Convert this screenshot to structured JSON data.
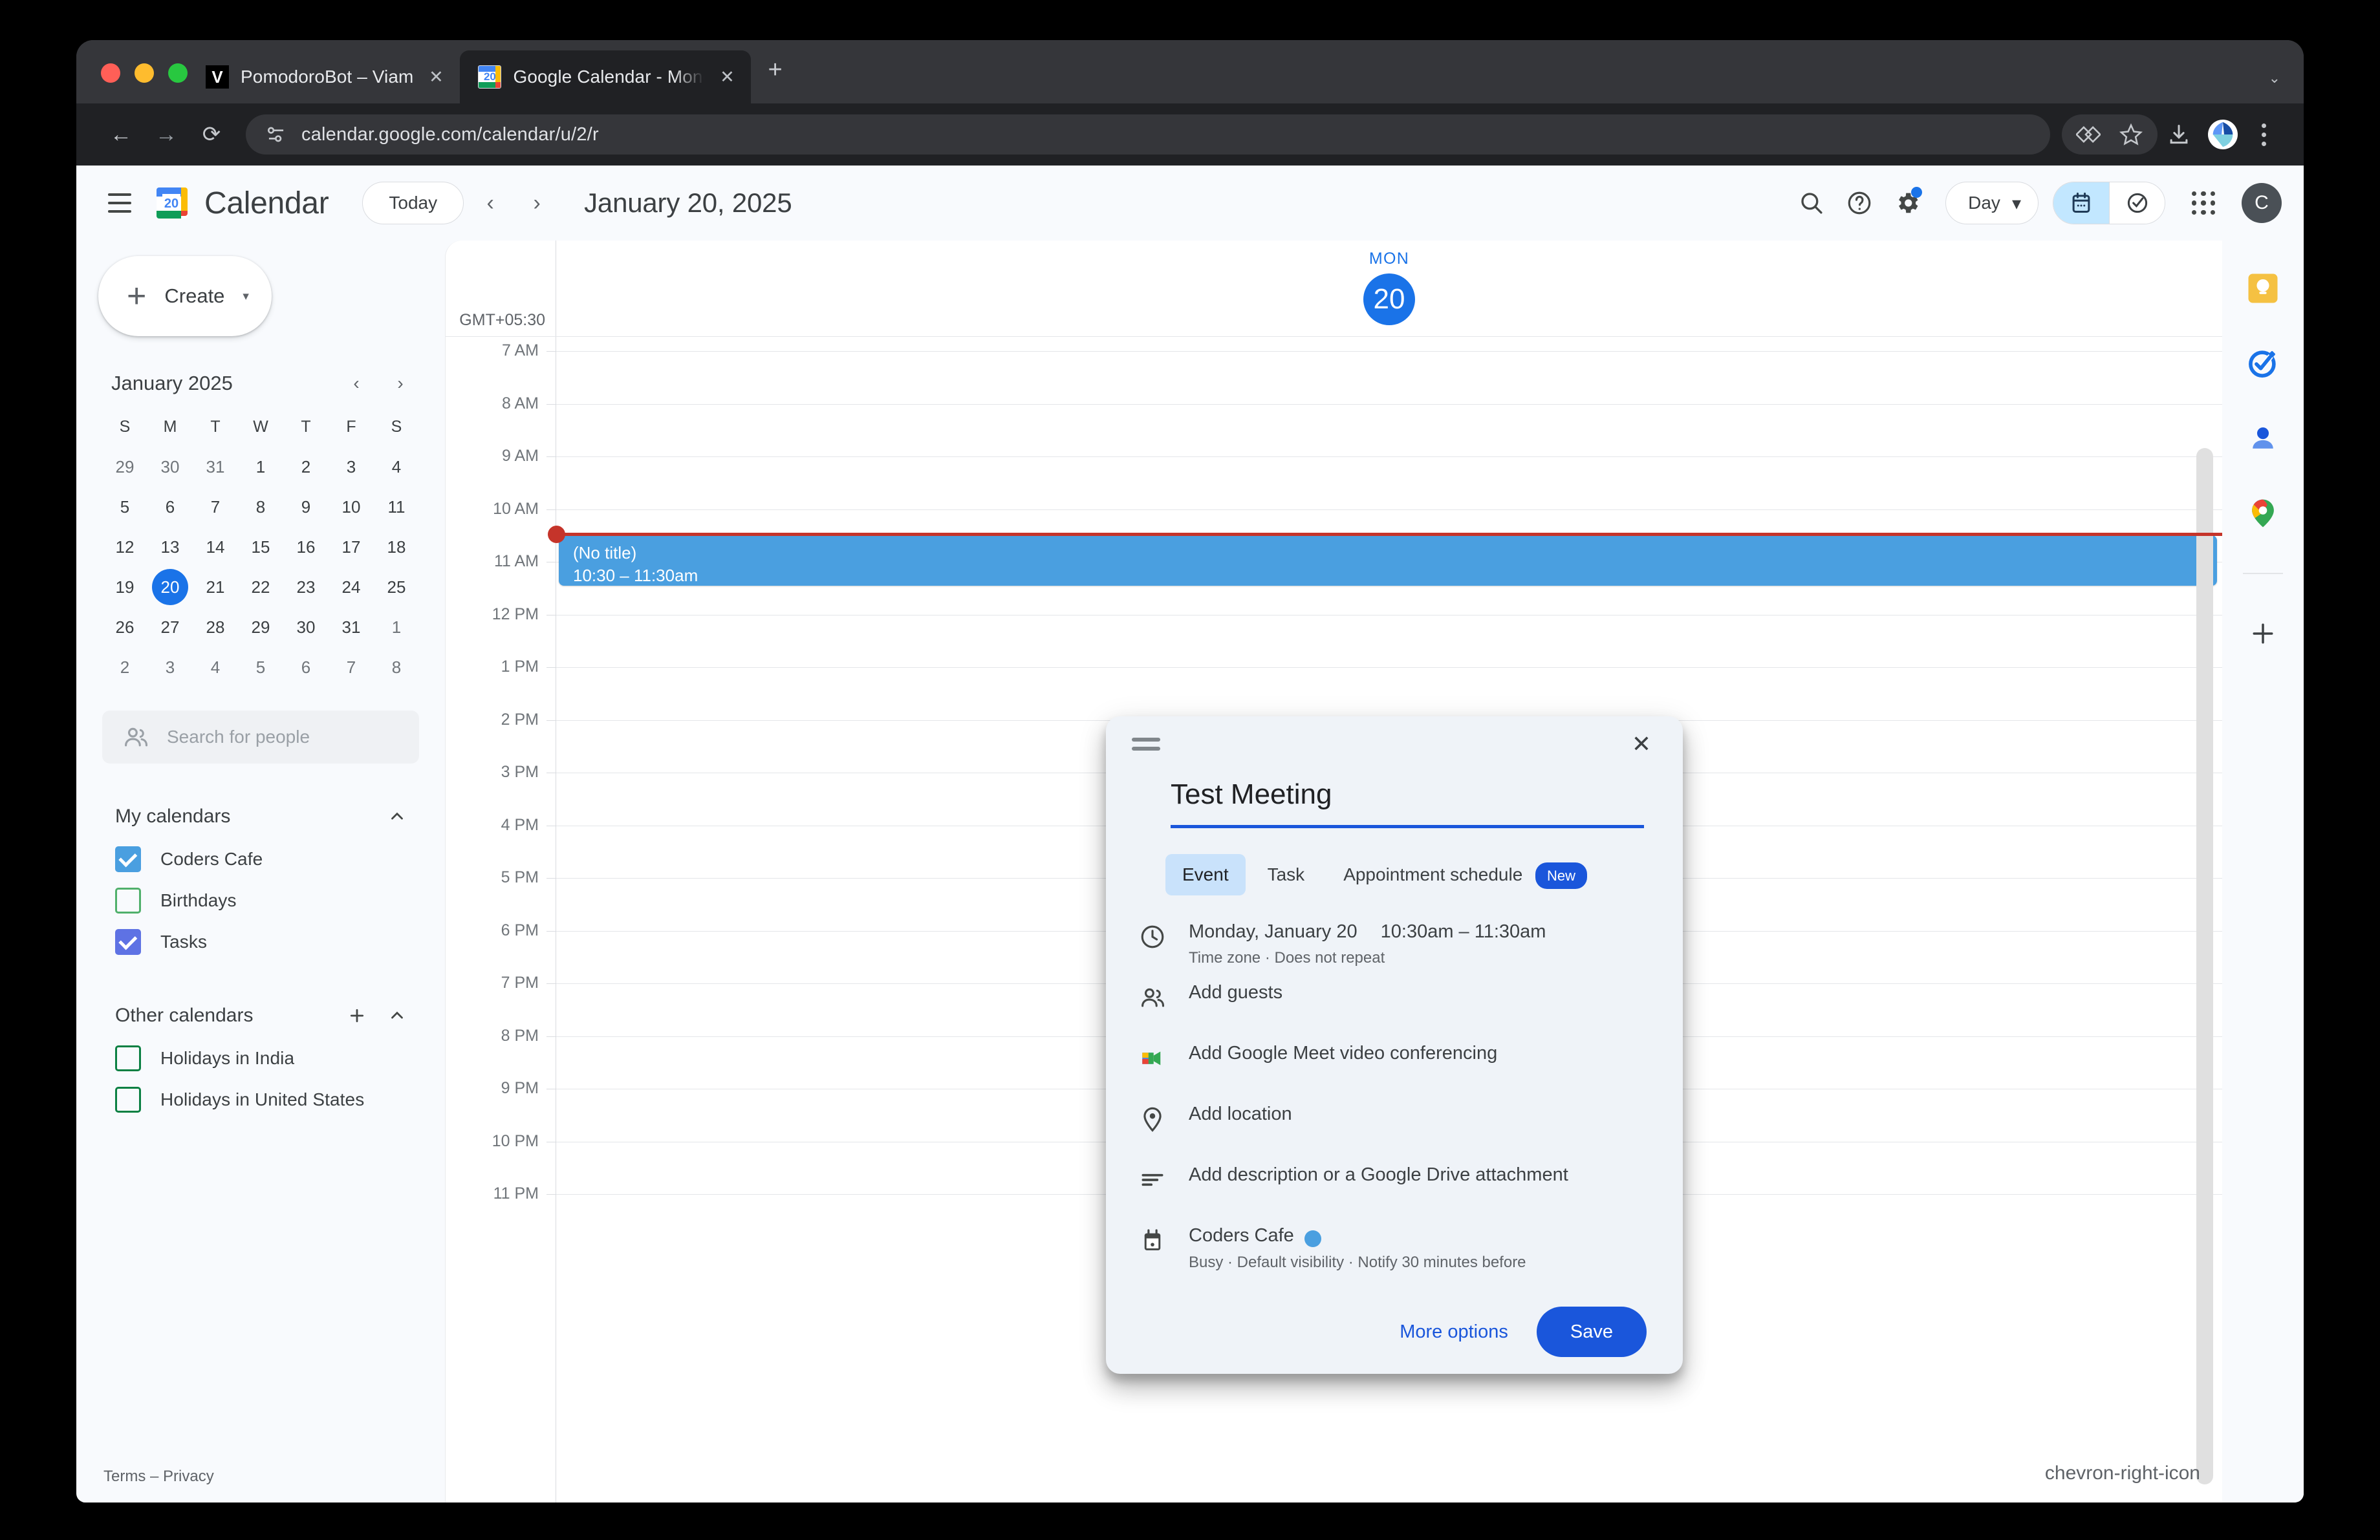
{
  "browser": {
    "tabs": [
      {
        "title": "PomodoroBot – Viam",
        "favicon": "viam-icon",
        "active": false
      },
      {
        "title": "Google Calendar - Monday, J",
        "favicon": "google-calendar-icon",
        "active": true
      }
    ],
    "new_tab_label": "+",
    "close_label": "✕",
    "url": "calendar.google.com/calendar/u/2/r",
    "nav": {
      "back": "←",
      "forward": "→",
      "reload": "⟳"
    },
    "toolbar_icons": [
      "split-view-icon",
      "bookmark-star-icon",
      "download-icon",
      "extension-icon",
      "chrome-menu-icon"
    ]
  },
  "header": {
    "menu_icon": "hamburger-menu-icon",
    "brand": "Calendar",
    "today_label": "Today",
    "prev_label": "‹",
    "next_label": "›",
    "date_title": "January 20, 2025",
    "search_icon": "search-icon",
    "help_icon": "help-icon",
    "settings_icon": "gear-icon",
    "view_label": "Day",
    "view_caret": "▾",
    "seg_calendar_icon": "calendar-view-icon",
    "seg_tasks_icon": "tasks-view-icon",
    "apps_icon": "apps-grid-icon",
    "avatar_letter": "C"
  },
  "sidebar": {
    "create": {
      "plus": "+",
      "label": "Create",
      "caret": "▾"
    },
    "mini_calendar": {
      "title": "January 2025",
      "prev": "‹",
      "next": "›",
      "dow": [
        "S",
        "M",
        "T",
        "W",
        "T",
        "F",
        "S"
      ],
      "weeks": [
        [
          {
            "d": "29",
            "muted": true
          },
          {
            "d": "30",
            "muted": true
          },
          {
            "d": "31",
            "muted": true
          },
          {
            "d": "1"
          },
          {
            "d": "2"
          },
          {
            "d": "3"
          },
          {
            "d": "4"
          }
        ],
        [
          {
            "d": "5"
          },
          {
            "d": "6"
          },
          {
            "d": "7"
          },
          {
            "d": "8"
          },
          {
            "d": "9"
          },
          {
            "d": "10"
          },
          {
            "d": "11"
          }
        ],
        [
          {
            "d": "12"
          },
          {
            "d": "13"
          },
          {
            "d": "14"
          },
          {
            "d": "15"
          },
          {
            "d": "16"
          },
          {
            "d": "17"
          },
          {
            "d": "18"
          }
        ],
        [
          {
            "d": "19"
          },
          {
            "d": "20",
            "selected": true
          },
          {
            "d": "21"
          },
          {
            "d": "22"
          },
          {
            "d": "23"
          },
          {
            "d": "24"
          },
          {
            "d": "25"
          }
        ],
        [
          {
            "d": "26"
          },
          {
            "d": "27"
          },
          {
            "d": "28"
          },
          {
            "d": "29"
          },
          {
            "d": "30"
          },
          {
            "d": "31"
          },
          {
            "d": "1",
            "muted": true
          }
        ],
        [
          {
            "d": "2",
            "muted": true
          },
          {
            "d": "3",
            "muted": true
          },
          {
            "d": "4",
            "muted": true
          },
          {
            "d": "5",
            "muted": true
          },
          {
            "d": "6",
            "muted": true
          },
          {
            "d": "7",
            "muted": true
          },
          {
            "d": "8",
            "muted": true
          }
        ]
      ]
    },
    "people_search": {
      "placeholder": "Search for people",
      "icon": "people-icon"
    },
    "my_calendars": {
      "title": "My calendars",
      "collapse_icon": "chevron-up-icon",
      "items": [
        {
          "label": "Coders Cafe",
          "checked": true,
          "color": "#4a9fe0"
        },
        {
          "label": "Birthdays",
          "checked": false,
          "color": "#50b06b"
        },
        {
          "label": "Tasks",
          "checked": true,
          "color": "#5e72e4"
        }
      ]
    },
    "other_calendars": {
      "title": "Other calendars",
      "add_icon": "plus-icon",
      "collapse_icon": "chevron-up-icon",
      "items": [
        {
          "label": "Holidays in India",
          "checked": false,
          "color": "#0b8043"
        },
        {
          "label": "Holidays in United States",
          "checked": false,
          "color": "#0b8043"
        }
      ]
    },
    "footer": "Terms – Privacy"
  },
  "calendar": {
    "timezone": "GMT+05:30",
    "day_of_week": "MON",
    "day_number": "20",
    "hours": [
      "7 AM",
      "8 AM",
      "9 AM",
      "10 AM",
      "11 AM",
      "12 PM",
      "1 PM",
      "2 PM",
      "3 PM",
      "4 PM",
      "5 PM",
      "6 PM",
      "7 PM",
      "8 PM",
      "9 PM",
      "10 PM",
      "11 PM"
    ],
    "events": [
      {
        "title": "(No title)",
        "time": "10:30 – 11:30am",
        "color": "#4a9fe0",
        "start_hour": 10.5,
        "end_hour": 11.5
      }
    ],
    "now_indicator": {
      "color": "#c5342a",
      "hour": 10.45
    },
    "expand_icon": "chevron-right-icon"
  },
  "side_panel": {
    "icons": [
      "keep-icon",
      "tasks-icon",
      "contacts-icon",
      "maps-icon",
      "add-app-icon"
    ]
  },
  "dialog": {
    "drag_handle_icon": "drag-handle-icon",
    "close_icon": "close-icon",
    "title": "Test Meeting",
    "tabs": [
      {
        "label": "Event",
        "active": true
      },
      {
        "label": "Task",
        "active": false
      },
      {
        "label": "Appointment schedule",
        "active": false,
        "badge": "New"
      }
    ],
    "rows": {
      "datetime": {
        "icon": "clock-icon",
        "date": "Monday, January 20",
        "times": "10:30am  –  11:30am",
        "secondary": "Time zone · Does not repeat"
      },
      "guests": {
        "icon": "people-icon",
        "label": "Add guests"
      },
      "meet": {
        "icon": "google-meet-icon",
        "label": "Add Google Meet video conferencing"
      },
      "location": {
        "icon": "location-pin-icon",
        "label": "Add location"
      },
      "description": {
        "icon": "description-icon",
        "label": "Add description or a Google Drive attachment"
      },
      "calendar": {
        "icon": "calendar-icon",
        "name": "Coders Cafe",
        "color": "#4a9fe0",
        "secondary": "Busy · Default visibility · Notify 30 minutes before"
      }
    },
    "more_options_label": "More options",
    "save_label": "Save"
  }
}
